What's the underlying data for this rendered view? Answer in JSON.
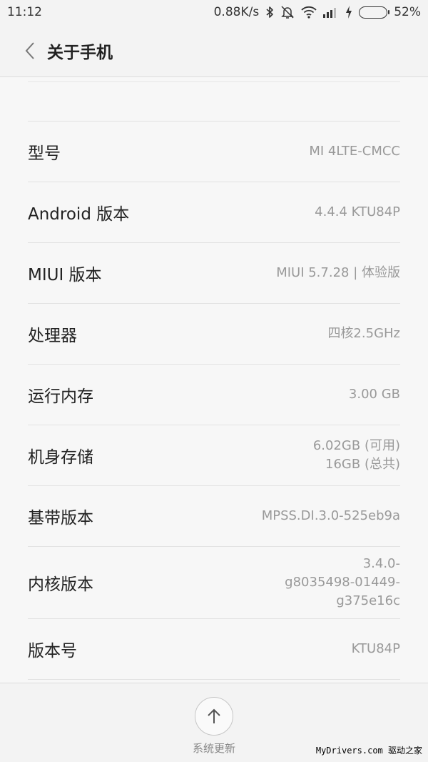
{
  "status_bar": {
    "time": "11:12",
    "network_speed": "0.88K/s",
    "battery_percent": "52%",
    "battery_level": 0.52,
    "icons": [
      "bluetooth-icon",
      "alarm-off-icon",
      "wifi-icon",
      "signal-icon",
      "charging-icon",
      "battery-icon"
    ]
  },
  "header": {
    "title": "关于手机"
  },
  "items": [
    {
      "label": "型号",
      "value": [
        "MI 4LTE-CMCC"
      ]
    },
    {
      "label": "Android 版本",
      "value": [
        "4.4.4 KTU84P"
      ]
    },
    {
      "label": "MIUI 版本",
      "value": [
        "MIUI 5.7.28 | 体验版"
      ]
    },
    {
      "label": "处理器",
      "value": [
        "四核2.5GHz"
      ]
    },
    {
      "label": "运行内存",
      "value": [
        "3.00 GB"
      ]
    },
    {
      "label": "机身存储",
      "value": [
        "6.02GB (可用)",
        "16GB (总共)"
      ]
    },
    {
      "label": "基带版本",
      "value": [
        "MPSS.DI.3.0-525eb9a"
      ]
    },
    {
      "label": "内核版本",
      "value": [
        "3.4.0-",
        "g8035498-01449-",
        "g375e16c"
      ]
    },
    {
      "label": "版本号",
      "value": [
        "KTU84P"
      ]
    }
  ],
  "footer": {
    "update_label": "系统更新",
    "watermark": "MyDrivers.com 驱动之家"
  },
  "colors": {
    "battery_fill": "#43c82e",
    "background": "#f7f7f7"
  }
}
